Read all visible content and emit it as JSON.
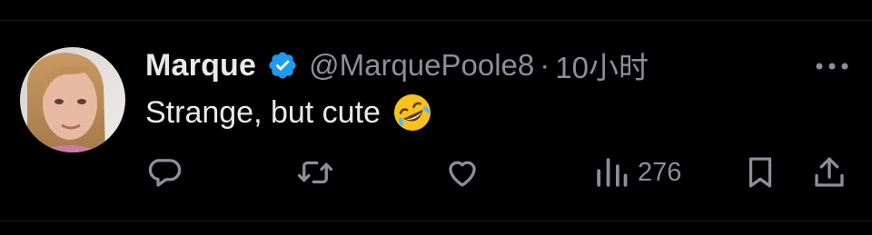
{
  "tweet": {
    "author": {
      "display_name": "Marque",
      "handle": "@MarquePoole8",
      "verified": true
    },
    "separator": "·",
    "timestamp": "10小时",
    "text": "Strange, but cute",
    "emoji": "rolling-on-the-floor-laughing",
    "metrics": {
      "views": "276"
    }
  },
  "colors": {
    "background": "#000000",
    "primary_text": "#e7e9ea",
    "secondary_text": "#8b9096",
    "verified_badge": "#1d9bf0"
  },
  "icons": {
    "reply": "reply-icon",
    "retweet": "retweet-icon",
    "like": "like-icon",
    "views": "views-icon",
    "bookmark": "bookmark-icon",
    "share": "share-icon",
    "more": "more-icon"
  }
}
